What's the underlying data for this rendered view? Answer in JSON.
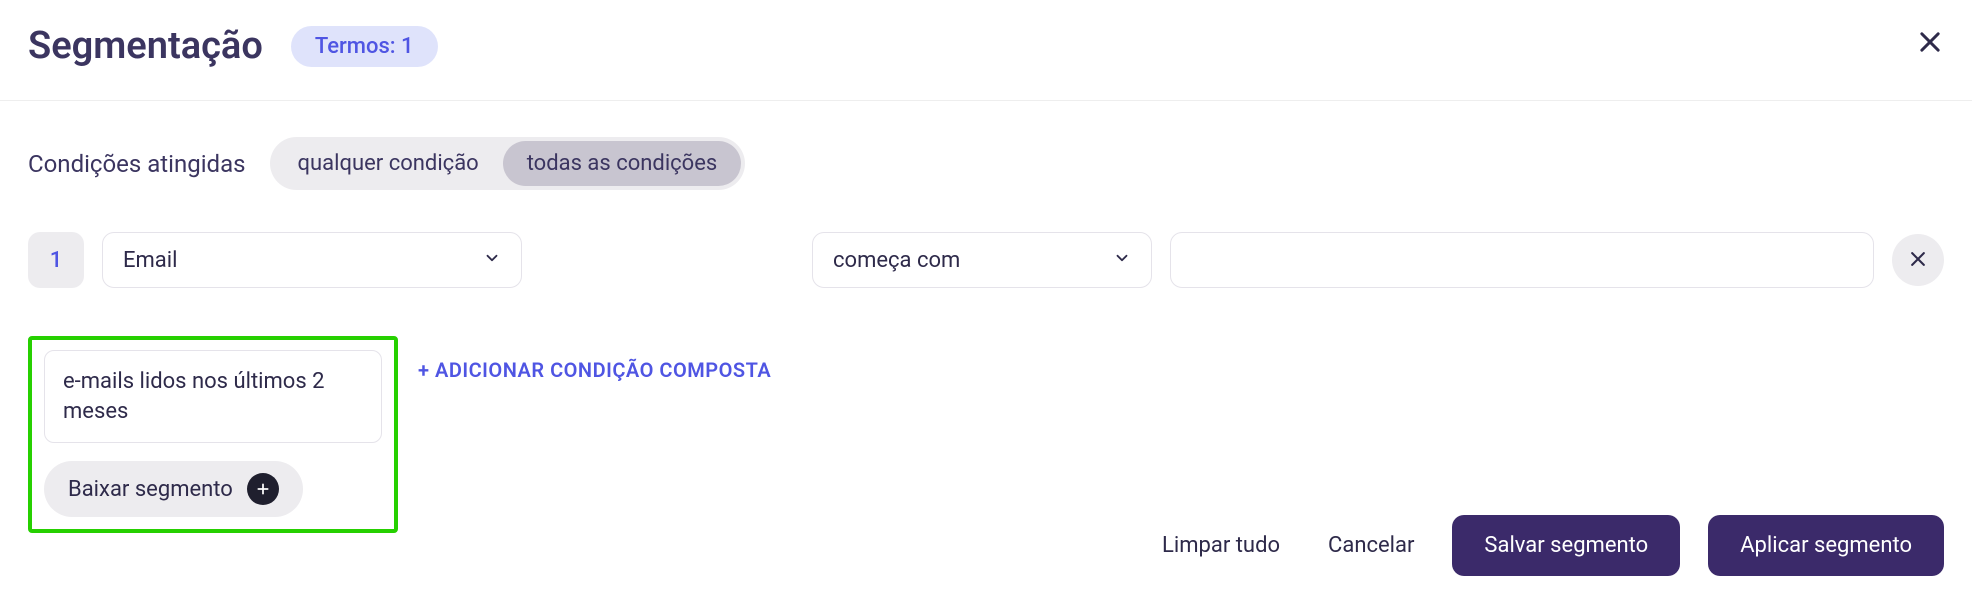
{
  "header": {
    "title": "Segmentação",
    "badge": "Termos: 1"
  },
  "conditions": {
    "label": "Condições atingidas",
    "toggle": {
      "any": "qualquer condição",
      "all": "todas as condições"
    }
  },
  "rule": {
    "index": "1",
    "field": "Email",
    "operator": "começa com",
    "value": ""
  },
  "composite": {
    "add": "+ ADICIONAR CONDIÇÃO COMPOSTA"
  },
  "segment": {
    "name": "e-mails lidos nos últimos 2 meses",
    "download": "Baixar segmento"
  },
  "footer": {
    "clear": "Limpar tudo",
    "cancel": "Cancelar",
    "save": "Salvar segmento",
    "apply": "Aplicar segmento"
  }
}
